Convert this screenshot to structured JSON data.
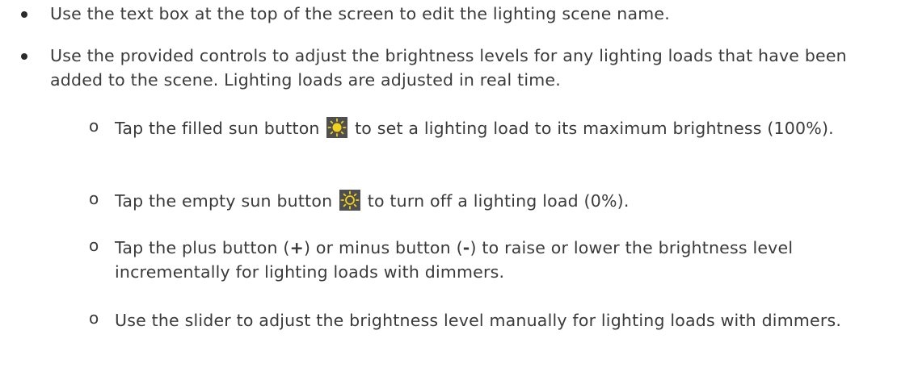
{
  "bullets": [
    {
      "text": "Use the text box at the top of the screen to edit the lighting scene name."
    },
    {
      "text": "Use the provided controls to adjust the brightness levels for any lighting loads that have been added to the scene. Lighting loads are adjusted in real time."
    }
  ],
  "sub_bullets": {
    "marker": "o",
    "filled_sun": {
      "before": "Tap the filled sun button",
      "after": "to set a lighting load to its maximum brightness (100%).",
      "icon": "sun-filled-icon"
    },
    "empty_sun": {
      "before": "Tap the empty sun button",
      "after": "to turn off a lighting load (0%).",
      "icon": "sun-empty-icon"
    },
    "plus_minus": {
      "text_a": "Tap the plus button (",
      "plus": "+",
      "text_b": ") or minus button (",
      "minus": "-",
      "text_c": ") to raise or lower the brightness level incrementally for lighting loads with dimmers."
    },
    "slider": {
      "text": "Use the slider to adjust the brightness level manually for lighting loads with dimmers."
    }
  },
  "colors": {
    "text": "#3a3a3a",
    "icon_bg": "#4f4f4f",
    "sun_yellow": "#f2d21b"
  }
}
